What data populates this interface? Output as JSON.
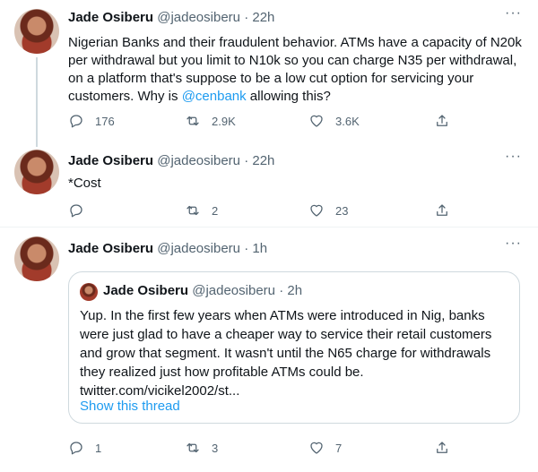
{
  "tweets": [
    {
      "name": "Jade Osiberu",
      "handle": "@jadeosiberu",
      "dot": "·",
      "time": "22h",
      "more": "···",
      "text_before": "Nigerian Banks and their fraudulent behavior. ATMs have a capacity of N20k per withdrawal but you limit to N10k so you can charge N35 per withdrawal, on a platform that's suppose to be a low cut option for servicing your customers. Why is ",
      "mention": "@cenbank",
      "text_after": " allowing this?",
      "replies": "176",
      "retweets": "2.9K",
      "likes": "3.6K"
    },
    {
      "name": "Jade Osiberu",
      "handle": "@jadeosiberu",
      "dot": "·",
      "time": "22h",
      "more": "···",
      "text": "*Cost",
      "replies": "",
      "retweets": "2",
      "likes": "23"
    },
    {
      "name": "Jade Osiberu",
      "handle": "@jadeosiberu",
      "dot": "·",
      "time": "1h",
      "more": "···",
      "replies": "1",
      "retweets": "3",
      "likes": "7",
      "quote": {
        "name": "Jade Osiberu",
        "handle": "@jadeosiberu",
        "dot": "·",
        "time": "2h",
        "text": "Yup. In the first few years when ATMs were introduced in Nig, banks were just glad to have a cheaper way to service their retail customers and grow that segment. It wasn't until the N65 charge for withdrawals they realized just how profitable ATMs could be. twitter.com/vicikel2002/st...",
        "show_thread": "Show this thread"
      }
    }
  ]
}
